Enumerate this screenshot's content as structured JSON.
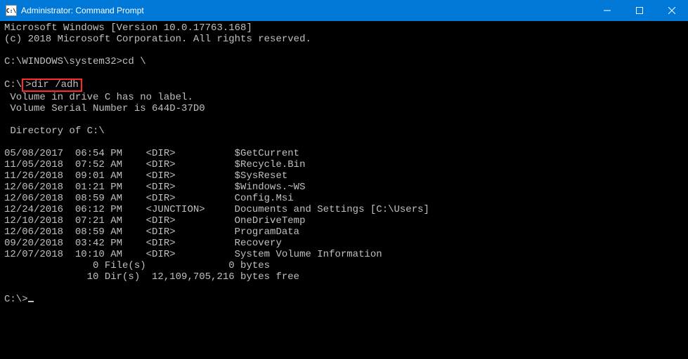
{
  "titlebar": {
    "icon_text": "C:\\",
    "title": "Administrator: Command Prompt"
  },
  "header": {
    "line1": "Microsoft Windows [Version 10.0.17763.168]",
    "line2": "(c) 2018 Microsoft Corporation. All rights reserved."
  },
  "prompt1": {
    "path": "C:\\WINDOWS\\system32>",
    "cmd": "cd \\"
  },
  "prompt2": {
    "path": "C:\\",
    "cmd": "dir /adh"
  },
  "vol": {
    "line1": " Volume in drive C has no label.",
    "line2": " Volume Serial Number is 644D-37D0",
    "dirof": " Directory of C:\\"
  },
  "rows": [
    {
      "date": "05/08/2017",
      "time": "06:54 PM",
      "type": "<DIR>         ",
      "name": "$GetCurrent"
    },
    {
      "date": "11/05/2018",
      "time": "07:52 AM",
      "type": "<DIR>         ",
      "name": "$Recycle.Bin"
    },
    {
      "date": "11/26/2018",
      "time": "09:01 AM",
      "type": "<DIR>         ",
      "name": "$SysReset"
    },
    {
      "date": "12/06/2018",
      "time": "01:21 PM",
      "type": "<DIR>         ",
      "name": "$Windows.~WS"
    },
    {
      "date": "12/06/2018",
      "time": "08:59 AM",
      "type": "<DIR>         ",
      "name": "Config.Msi"
    },
    {
      "date": "12/24/2016",
      "time": "06:12 PM",
      "type": "<JUNCTION>    ",
      "name": "Documents and Settings [C:\\Users]"
    },
    {
      "date": "12/10/2018",
      "time": "07:21 AM",
      "type": "<DIR>         ",
      "name": "OneDriveTemp"
    },
    {
      "date": "12/06/2018",
      "time": "08:59 AM",
      "type": "<DIR>         ",
      "name": "ProgramData"
    },
    {
      "date": "09/20/2018",
      "time": "03:42 PM",
      "type": "<DIR>         ",
      "name": "Recovery"
    },
    {
      "date": "12/07/2018",
      "time": "10:10 AM",
      "type": "<DIR>         ",
      "name": "System Volume Information"
    }
  ],
  "summary": {
    "files": "               0 File(s)              0 bytes",
    "dirs": "              10 Dir(s)  12,109,705,216 bytes free"
  },
  "prompt3": {
    "path": "C:\\>"
  }
}
